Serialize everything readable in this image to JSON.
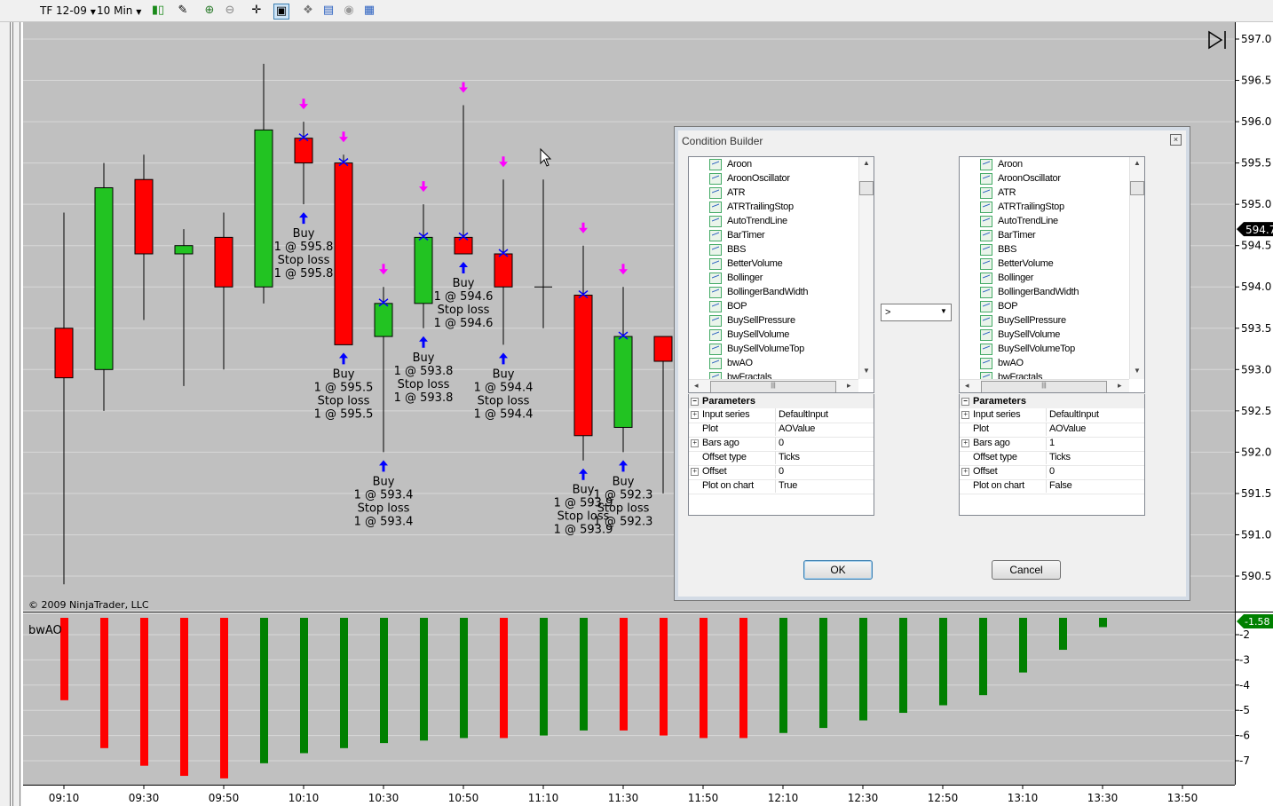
{
  "toolbar": {
    "instrument": "TF 12-09",
    "interval": "10 Min"
  },
  "chart_price": {
    "y_ticks": [
      "597.0",
      "596.5",
      "596.0",
      "595.5",
      "595.0",
      "594.5",
      "594.0",
      "593.5",
      "593.0",
      "592.5",
      "592.0",
      "591.5",
      "591.0",
      "590.5"
    ],
    "current_price": "594.7",
    "copyright": "© 2009 NinjaTrader, LLC",
    "candles": [
      {
        "o": 593.5,
        "h": 594.9,
        "l": 590.4,
        "c": 592.9
      },
      {
        "o": 593.0,
        "h": 595.5,
        "l": 592.5,
        "c": 595.2
      },
      {
        "o": 595.3,
        "h": 595.6,
        "l": 593.6,
        "c": 594.4
      },
      {
        "o": 594.4,
        "h": 594.7,
        "l": 592.8,
        "c": 594.5
      },
      {
        "o": 594.6,
        "h": 594.9,
        "l": 593.0,
        "c": 594.0
      },
      {
        "o": 594.0,
        "h": 596.7,
        "l": 593.8,
        "c": 595.9
      },
      {
        "o": 595.8,
        "h": 596.0,
        "l": 595.0,
        "c": 595.5
      },
      {
        "o": 595.5,
        "h": 595.6,
        "l": 593.3,
        "c": 593.3
      },
      {
        "o": 593.4,
        "h": 594.0,
        "l": 592.0,
        "c": 593.8
      },
      {
        "o": 593.8,
        "h": 595.0,
        "l": 593.5,
        "c": 594.6
      },
      {
        "o": 594.6,
        "h": 596.2,
        "l": 594.4,
        "c": 594.4
      },
      {
        "o": 594.4,
        "h": 595.3,
        "l": 593.3,
        "c": 594.0
      },
      {
        "o": 594.0,
        "h": 595.3,
        "l": 593.5,
        "c": 594.0
      },
      {
        "o": 593.9,
        "h": 594.5,
        "l": 591.9,
        "c": 592.2
      },
      {
        "o": 592.3,
        "h": 594.0,
        "l": 592.0,
        "c": 593.4
      },
      {
        "o": 593.4,
        "h": 593.4,
        "l": 591.5,
        "c": 593.1
      }
    ],
    "buy_annotations": [
      {
        "bar": 6,
        "lines": [
          "Buy",
          "1 @ 595.8",
          "Stop loss",
          "1 @ 595.8"
        ]
      },
      {
        "bar": 7,
        "lines": [
          "Buy",
          "1 @ 595.5",
          "Stop loss",
          "1 @ 595.5"
        ]
      },
      {
        "bar": 8,
        "lines": [
          "Buy",
          "1 @ 593.4",
          "Stop loss",
          "1 @ 593.4"
        ]
      },
      {
        "bar": 9,
        "lines": [
          "Buy",
          "1 @ 593.8",
          "Stop loss",
          "1 @ 593.8"
        ]
      },
      {
        "bar": 10,
        "lines": [
          "Buy",
          "1 @ 594.6",
          "Stop loss",
          "1 @ 594.6"
        ]
      },
      {
        "bar": 11,
        "lines": [
          "Buy",
          "1 @ 594.4",
          "Stop loss",
          "1 @ 594.4"
        ]
      },
      {
        "bar": 13,
        "lines": [
          "Buy",
          "1 @ 593.9",
          "Stop loss",
          "1 @ 593.9"
        ]
      },
      {
        "bar": 14,
        "lines": [
          "Buy",
          "1 @ 592.3",
          "Stop loss",
          "1 @ 592.3"
        ]
      }
    ]
  },
  "chart_indicator": {
    "label": "bwAO",
    "current_value": "-1.58",
    "y_ticks": [
      "-2",
      "-3",
      "-4",
      "-5",
      "-6",
      "-7"
    ],
    "values": [
      -4.6,
      -6.5,
      -7.2,
      -7.6,
      -7.7,
      -7.1,
      -6.7,
      -6.5,
      -6.3,
      -6.2,
      -6.1,
      -6.1,
      -6.0,
      -5.8,
      -5.8,
      -6.0,
      -6.1,
      -6.1,
      -5.9,
      -5.7,
      -5.4,
      -5.1,
      -4.8,
      -4.4,
      -3.5,
      -2.6,
      -1.7
    ],
    "colors": [
      "red",
      "red",
      "red",
      "red",
      "red",
      "green",
      "green",
      "green",
      "green",
      "green",
      "green",
      "red",
      "green",
      "green",
      "red",
      "red",
      "red",
      "red",
      "green",
      "green",
      "green",
      "green",
      "green",
      "green",
      "green",
      "green",
      "green"
    ],
    "x_ticks": [
      "09:10",
      "09:30",
      "09:50",
      "10:10",
      "10:30",
      "10:50",
      "11:10",
      "11:30",
      "11:50",
      "12:10",
      "12:30",
      "12:50",
      "13:10",
      "13:30",
      "13:50"
    ]
  },
  "colors": {
    "up_candle": "#22c322",
    "down_candle": "#ff0000",
    "buy_arrow": "#0000ff",
    "exit_arrow": "#ff00ff",
    "chart_bg": "#c0c0c0",
    "ao_red": "#ff0000",
    "ao_green": "#008000"
  },
  "dialog": {
    "title": "Condition Builder",
    "indicators": [
      "Aroon",
      "AroonOscillator",
      "ATR",
      "ATRTrailingStop",
      "AutoTrendLine",
      "BarTimer",
      "BBS",
      "BetterVolume",
      "Bollinger",
      "BollingerBandWidth",
      "BOP",
      "BuySellPressure",
      "BuySellVolume",
      "BuySellVolumeTop",
      "bwAO",
      "bwFractals"
    ],
    "operator": ">",
    "params_header": "Parameters",
    "left": {
      "params": [
        {
          "key": "Input series",
          "value": "DefaultInput",
          "expandable": true
        },
        {
          "key": "Plot",
          "value": "AOValue",
          "expandable": false
        },
        {
          "key": "Bars ago",
          "value": "0",
          "expandable": true
        },
        {
          "key": "Offset type",
          "value": "Ticks",
          "expandable": false
        },
        {
          "key": "Offset",
          "value": "0",
          "expandable": true
        },
        {
          "key": "Plot on chart",
          "value": "True",
          "expandable": false
        }
      ]
    },
    "right": {
      "params": [
        {
          "key": "Input series",
          "value": "DefaultInput",
          "expandable": true
        },
        {
          "key": "Plot",
          "value": "AOValue",
          "expandable": false
        },
        {
          "key": "Bars ago",
          "value": "1",
          "expandable": true
        },
        {
          "key": "Offset type",
          "value": "Ticks",
          "expandable": false
        },
        {
          "key": "Offset",
          "value": "0",
          "expandable": true
        },
        {
          "key": "Plot on chart",
          "value": "False",
          "expandable": false
        }
      ]
    },
    "ok_label": "OK",
    "cancel_label": "Cancel"
  }
}
